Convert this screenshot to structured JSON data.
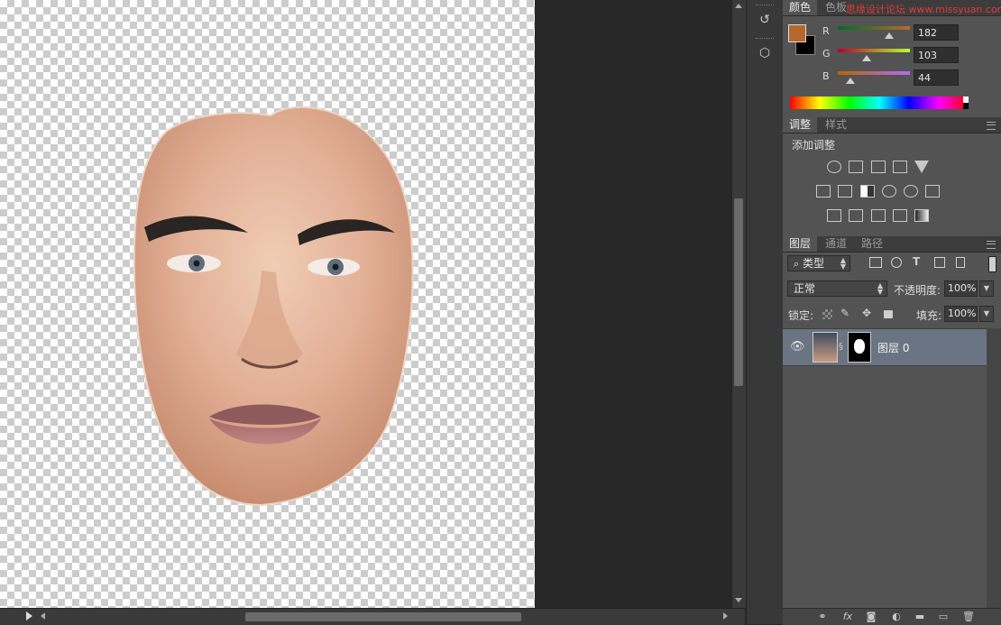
{
  "watermark": "思缘设计论坛 www.missyuan.com",
  "color_panel": {
    "tabs": [
      "颜色",
      "色板"
    ],
    "foreground": "#b6672c",
    "background": "#000000",
    "channels": [
      {
        "label": "R",
        "value": "182",
        "level": 0.714
      },
      {
        "label": "G",
        "value": "103",
        "level": 0.404
      },
      {
        "label": "B",
        "value": "44",
        "level": 0.173
      }
    ]
  },
  "adjustments_panel": {
    "tabs": [
      "调整",
      "样式"
    ],
    "heading": "添加调整",
    "icons": [
      [
        "brightness-icon",
        "levels-icon",
        "curves-icon",
        "exposure-icon",
        "vibrance-icon"
      ],
      [
        "hue-saturation-icon",
        "color-balance-icon",
        "black-white-icon",
        "photo-filter-icon",
        "channel-mixer-icon",
        "color-lookup-icon"
      ],
      [
        "invert-icon",
        "posterize-icon",
        "threshold-icon",
        "selective-color-icon",
        "gradient-map-icon"
      ]
    ]
  },
  "layers_panel": {
    "tabs": [
      "图层",
      "通道",
      "路径"
    ],
    "filter_kind": "类型",
    "blend_mode": "正常",
    "opacity_label": "不透明度:",
    "opacity_value": "100%",
    "lock_label": "锁定:",
    "fill_label": "填充:",
    "fill_value": "100%",
    "layers": [
      {
        "name": "图层 0",
        "visible": true,
        "has_mask": true
      }
    ],
    "bottom_icons": [
      "link-icon",
      "fx-icon",
      "add-mask-icon",
      "adjustment-layer-icon",
      "group-icon",
      "new-layer-icon",
      "trash-icon"
    ],
    "fx_label": "fx"
  }
}
